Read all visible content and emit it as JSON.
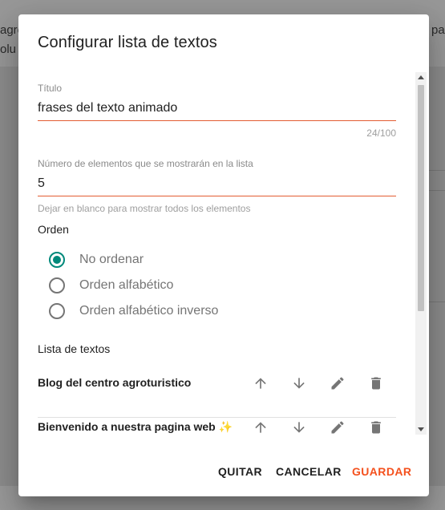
{
  "background": {
    "left_snippet_1": "agre",
    "left_snippet_2": "olu",
    "right_snippet": "pa"
  },
  "dialog": {
    "title": "Configurar lista de textos",
    "title_field": {
      "label": "Título",
      "value": "frases del texto animado",
      "counter": "24/100"
    },
    "count_field": {
      "label": "Número de elementos que se mostrarán en la lista",
      "value": "5",
      "hint": "Dejar en blanco para mostrar todos los elementos"
    },
    "order": {
      "label": "Orden",
      "options": [
        {
          "label": "No ordenar",
          "checked": true
        },
        {
          "label": "Orden alfabético",
          "checked": false
        },
        {
          "label": "Orden alfabético inverso",
          "checked": false
        }
      ]
    },
    "list": {
      "label": "Lista de textos",
      "items": [
        {
          "text": "Blog del centro agroturistico"
        },
        {
          "text": "Bienvenido a nuestra pagina web ✨"
        }
      ]
    },
    "actions": {
      "remove": "QUITAR",
      "cancel": "CANCELAR",
      "save": "GUARDAR"
    }
  },
  "colors": {
    "accent": "#f4511e",
    "underline": "#e35d32",
    "radio_checked": "#00897b"
  },
  "icons": [
    "arrow-up-icon",
    "arrow-down-icon",
    "edit-icon",
    "delete-icon"
  ]
}
